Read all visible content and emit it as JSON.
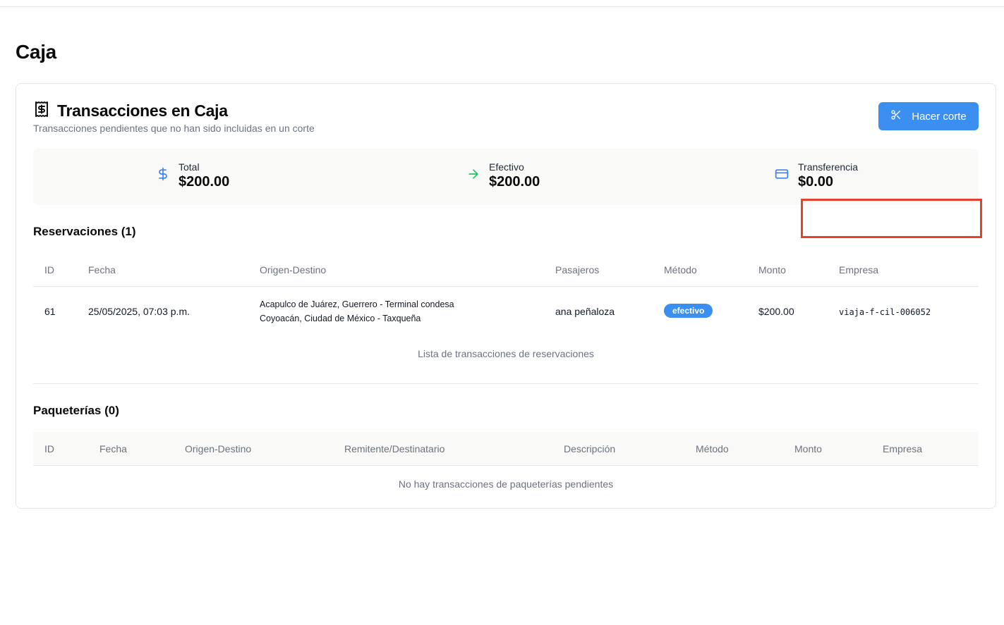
{
  "page": {
    "title": "Caja"
  },
  "card": {
    "title": "Transacciones en Caja",
    "subtitle": "Transacciones pendientes que no han sido incluidas en un corte",
    "button_label": "Hacer corte"
  },
  "summary": {
    "total": {
      "label": "Total",
      "value": "$200.00",
      "icon": "dollar-icon",
      "color": "#3b82f6"
    },
    "efectivo": {
      "label": "Efectivo",
      "value": "$200.00",
      "icon": "arrow-right-icon",
      "color": "#22c55e"
    },
    "transferencia": {
      "label": "Transferencia",
      "value": "$0.00",
      "icon": "credit-card-icon",
      "color": "#3b82f6"
    }
  },
  "reservaciones": {
    "title": "Reservaciones (1)",
    "columns": [
      "ID",
      "Fecha",
      "Origen-Destino",
      "Pasajeros",
      "Método",
      "Monto",
      "Empresa"
    ],
    "rows": [
      {
        "id": "61",
        "fecha": "25/05/2025, 07:03 p.m.",
        "origen": "Acapulco de Juárez, Guerrero - Terminal condesa",
        "destino": "Coyoacán, Ciudad de México - Taxqueña",
        "pasajeros": "ana peñaloza",
        "metodo": "efectivo",
        "monto": "$200.00",
        "empresa": "viaja-f-cil-006052"
      }
    ],
    "caption": "Lista de transacciones de reservaciones"
  },
  "paqueterias": {
    "title": "Paqueterías (0)",
    "columns": [
      "ID",
      "Fecha",
      "Origen-Destino",
      "Remitente/Destinatario",
      "Descripción",
      "Método",
      "Monto",
      "Empresa"
    ],
    "empty_text": "No hay transacciones de paqueterías pendientes"
  },
  "colors": {
    "accent": "#3b8ff0",
    "highlight_box": "#e5412d"
  }
}
